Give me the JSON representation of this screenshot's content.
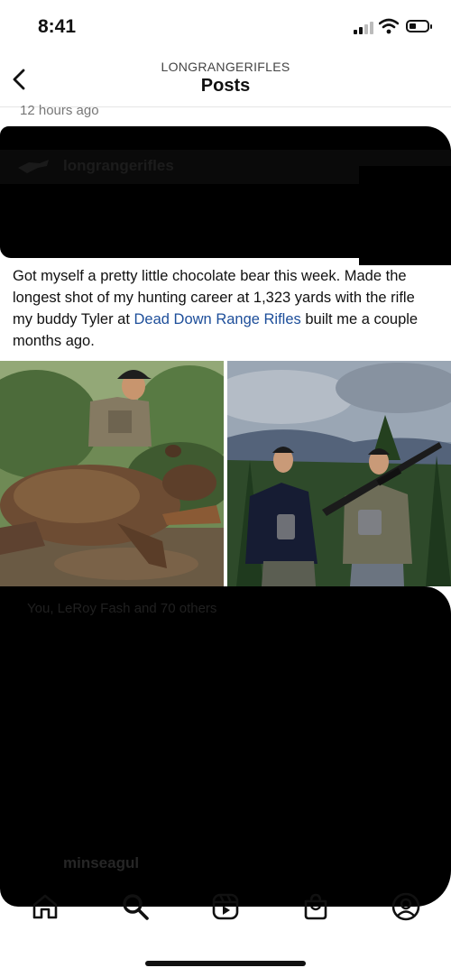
{
  "status_bar": {
    "time": "8:41"
  },
  "nav": {
    "account": "LONGRANGERIFLES",
    "title": "Posts"
  },
  "post": {
    "time_ago": "12 hours ago",
    "author": "longrangerifles",
    "caption_before_link": "Got myself a pretty little chocolate bear this week. Made the longest shot of my hunting career at 1,323 yards with the rifle my buddy Tyler at ",
    "caption_link": "Dead Down Range Rifles",
    "caption_after_link": " built me a couple months ago.",
    "likes": "You, LeRoy Fash and 70 others",
    "comment_author": "minseagul"
  },
  "icons": {
    "back": "chevron-left-icon",
    "home": "home-icon",
    "search": "search-icon",
    "reels": "reels-icon",
    "shop": "shop-bag-icon",
    "profile": "profile-icon"
  },
  "colors": {
    "link": "#1d4e9a",
    "redaction": "#000000"
  }
}
